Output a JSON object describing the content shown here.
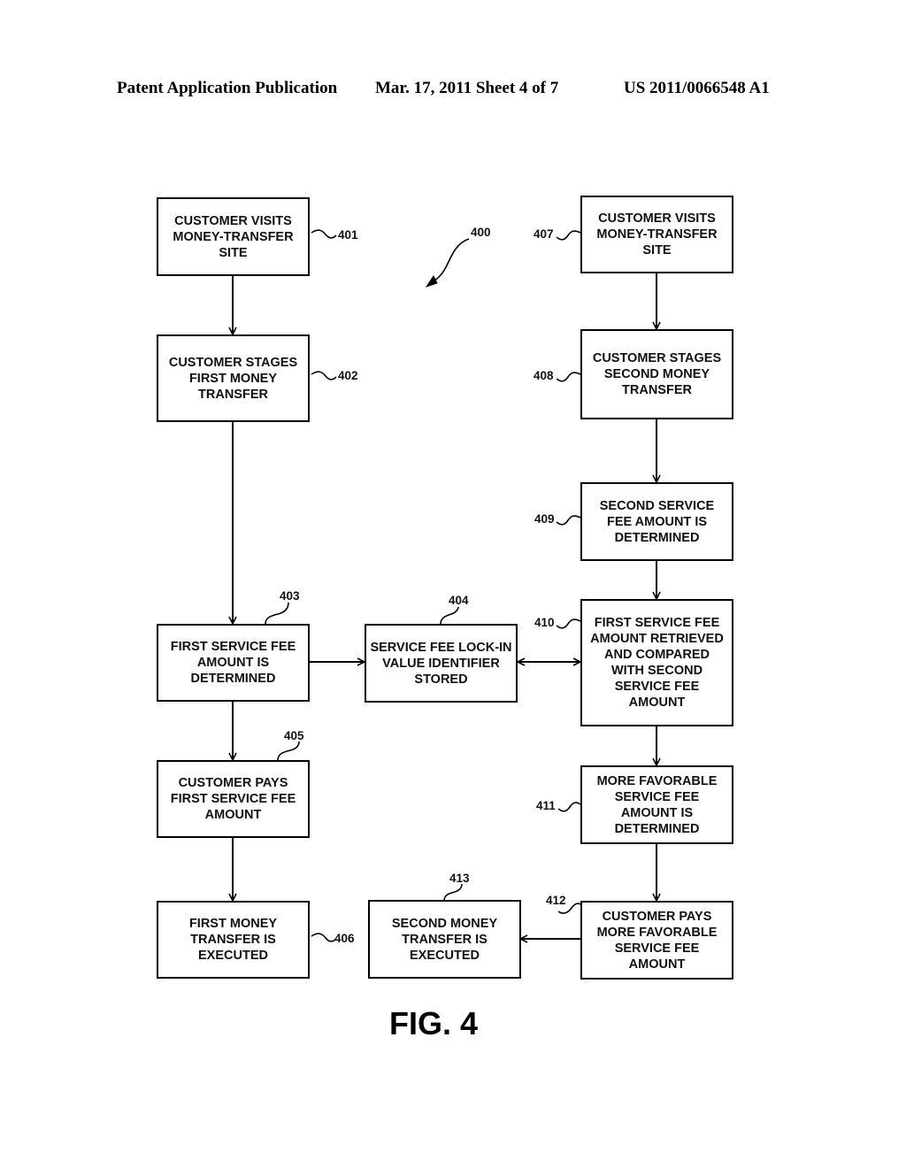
{
  "header": {
    "publication": "Patent Application Publication",
    "date_sheet": "Mar. 17, 2011  Sheet 4 of 7",
    "number": "US 2011/0066548 A1"
  },
  "figure": {
    "label": "FIG. 4",
    "ref": "400"
  },
  "boxes": {
    "b401": {
      "ref": "401",
      "text": "CUSTOMER VISITS\nMONEY-TRANSFER\nSITE"
    },
    "b402": {
      "ref": "402",
      "text": "CUSTOMER STAGES\nFIRST MONEY\nTRANSFER"
    },
    "b403": {
      "ref": "403",
      "text": "FIRST SERVICE FEE\nAMOUNT IS\nDETERMINED"
    },
    "b404": {
      "ref": "404",
      "text": "SERVICE FEE LOCK-IN\nVALUE IDENTIFIER\nSTORED"
    },
    "b405": {
      "ref": "405",
      "text": "CUSTOMER PAYS\nFIRST SERVICE FEE\nAMOUNT"
    },
    "b406": {
      "ref": "406",
      "text": "FIRST MONEY\nTRANSFER IS\nEXECUTED"
    },
    "b407": {
      "ref": "407",
      "text": "CUSTOMER VISITS\nMONEY-TRANSFER\nSITE"
    },
    "b408": {
      "ref": "408",
      "text": "CUSTOMER STAGES\nSECOND MONEY\nTRANSFER"
    },
    "b409": {
      "ref": "409",
      "text": "SECOND SERVICE\nFEE AMOUNT IS\nDETERMINED"
    },
    "b410": {
      "ref": "410",
      "text": "FIRST SERVICE FEE\nAMOUNT RETRIEVED\nAND COMPARED\nWITH SECOND\nSERVICE FEE\nAMOUNT"
    },
    "b411": {
      "ref": "411",
      "text": "MORE FAVORABLE\nSERVICE FEE\nAMOUNT IS\nDETERMINED"
    },
    "b412": {
      "ref": "412",
      "text": "CUSTOMER PAYS\nMORE FAVORABLE\nSERVICE FEE\nAMOUNT"
    },
    "b413": {
      "ref": "413",
      "text": "SECOND MONEY\nTRANSFER IS\nEXECUTED"
    }
  }
}
